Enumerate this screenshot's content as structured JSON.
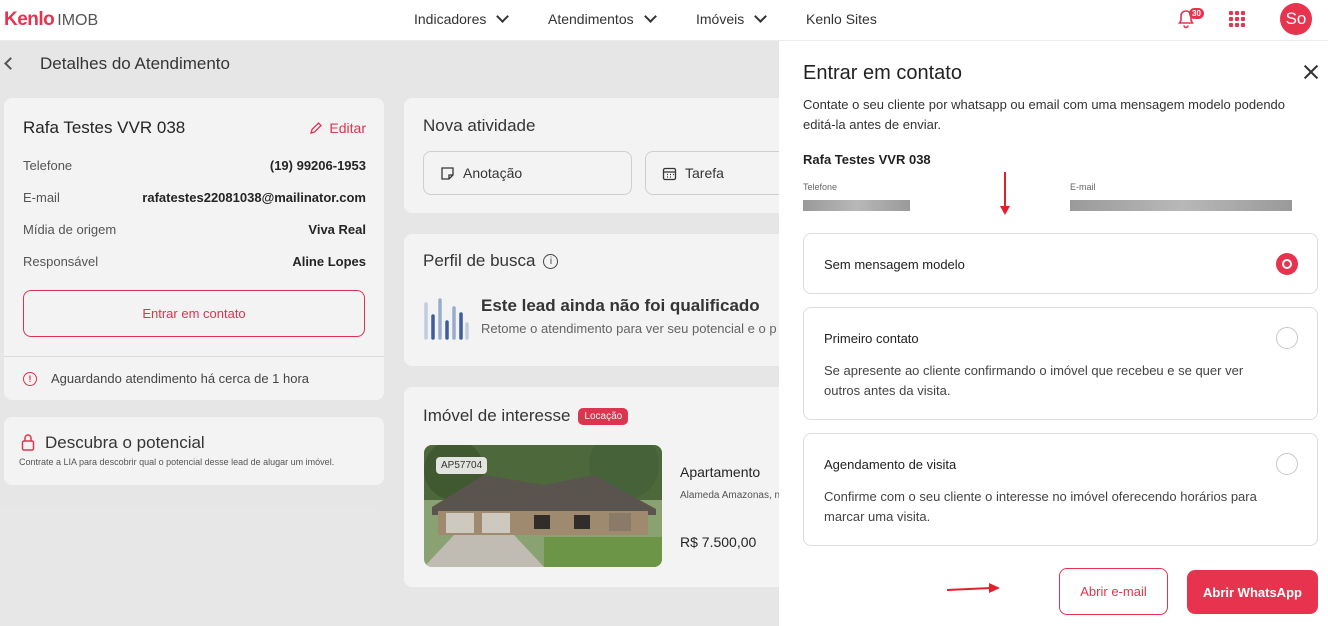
{
  "brand": {
    "name": "Kenlo",
    "sub": "IMOB",
    "accent": "#e8334f"
  },
  "nav": [
    {
      "label": "Indicadores"
    },
    {
      "label": "Atendimentos"
    },
    {
      "label": "Imóveis"
    },
    {
      "label": "Kenlo Sites"
    }
  ],
  "notifications": {
    "count": "30"
  },
  "user": {
    "initials": "So"
  },
  "page": {
    "title": "Detalhes do Atendimento",
    "lead": {
      "name": "Rafa Testes VVR 038",
      "edit_label": "Editar",
      "fields": [
        {
          "label": "Telefone",
          "value": "(19) 99206-1953"
        },
        {
          "label": "E-mail",
          "value": "rafatestes22081038@mailinator.com"
        },
        {
          "label": "Mídia de origem",
          "value": "Viva Real"
        },
        {
          "label": "Responsável",
          "value": "Aline Lopes"
        }
      ],
      "contact_button": "Entrar em contato",
      "status": "Aguardando atendimento há cerca de 1 hora"
    },
    "potential": {
      "title": "Descubra o potencial",
      "desc": "Contrate a LIA para descobrir qual o potencial desse lead de alugar um imóvel."
    },
    "new_activity": {
      "title": "Nova atividade",
      "buttons": [
        "Anotação",
        "Tarefa"
      ]
    },
    "search_profile": {
      "title": "Perfil de busca",
      "headline": "Este lead ainda não foi qualificado",
      "sub": "Retome o atendimento para ver seu potencial e o p"
    },
    "property": {
      "title": "Imóvel de interesse",
      "tag": "Locação",
      "code": "AP57704",
      "type": "Apartamento",
      "address": "Alameda Amazonas, n",
      "price": "R$ 7.500,00"
    }
  },
  "drawer": {
    "title": "Entrar em contato",
    "description": "Contate o seu cliente por whatsapp ou email com uma mensagem modelo podendo editá-la antes de enviar.",
    "client_name": "Rafa Testes VVR 038",
    "phone_label": "Telefone",
    "email_label": "E-mail",
    "options": [
      {
        "title": "Sem mensagem modelo",
        "desc": "",
        "selected": true
      },
      {
        "title": "Primeiro contato",
        "desc": "Se apresente ao cliente confirmando o imóvel que recebeu e se quer ver outros antes da visita.",
        "selected": false
      },
      {
        "title": "Agendamento de visita",
        "desc": "Confirme com o seu cliente o interesse no imóvel oferecendo horários para marcar uma visita.",
        "selected": false
      }
    ],
    "email_button": "Abrir e-mail",
    "whatsapp_button": "Abrir WhatsApp"
  }
}
